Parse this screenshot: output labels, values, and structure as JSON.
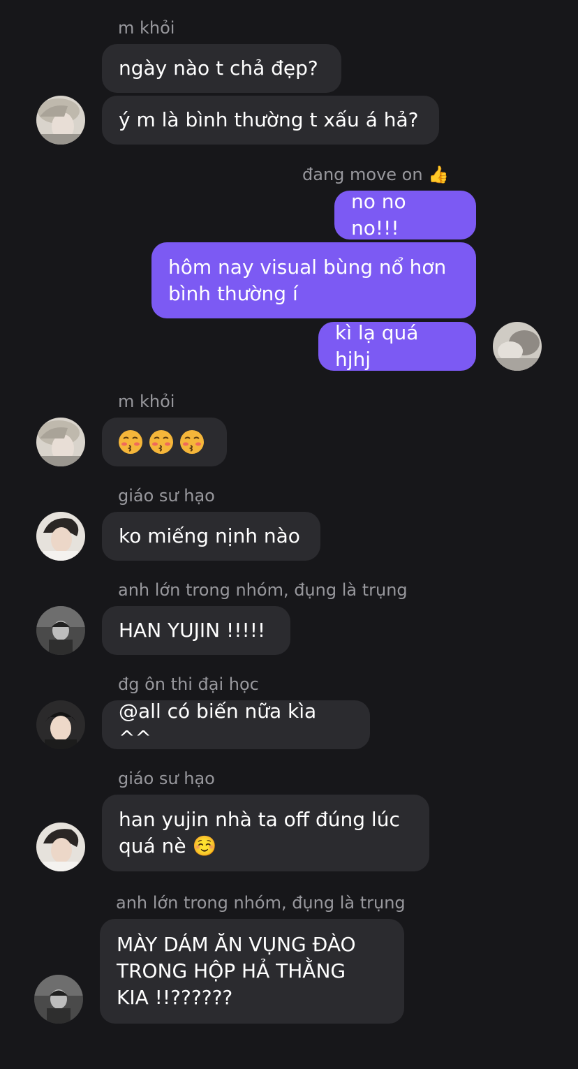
{
  "messages": {
    "m1": {
      "sender": "m khỏi",
      "lines": [
        "ngày nào t chả đẹp?",
        "ý m là bình thường t xấu á hả?"
      ]
    },
    "m2": {
      "sender": "đang move on 👍",
      "lines": [
        "no no no!!!",
        "hôm nay visual bùng nổ hơn\nbình thường í",
        "kì lạ quá hjhj"
      ]
    },
    "m3": {
      "sender": "m khỏi",
      "lines": [
        "😚😚😚"
      ]
    },
    "m4": {
      "sender": "giáo sư hạo",
      "lines": [
        "ko miếng nịnh nào"
      ]
    },
    "m5": {
      "sender": "anh lớn trong nhóm, đụng là trụng",
      "lines": [
        "HAN YUJIN !!!!!"
      ]
    },
    "m6": {
      "sender": "đg ôn thi đại học",
      "lines": [
        "@all có biến nữa kìa ^^"
      ]
    },
    "m7": {
      "sender": "giáo sư hạo",
      "lines": [
        "han yujin nhà ta off đúng lúc\nquá nè ☺️"
      ]
    },
    "m8": {
      "sender": "anh lớn trong nhóm, đụng là trụng",
      "lines": [
        "MÀY DÁM ĂN VỤNG ĐÀO\nTRONG HỘP HẢ THẰNG\nKIA !!??????"
      ]
    }
  },
  "avatars": {
    "khoi": "avatar-m-khoi",
    "self": "avatar-self",
    "hao": "avatar-giao-su-hao",
    "anh_lon": "avatar-anh-lon",
    "dg": "avatar-dg-on-thi"
  },
  "colors": {
    "background": "#17171a",
    "incoming_bubble": "#2b2b2f",
    "outgoing_bubble": "#7c5af3",
    "sender_name": "#98989d"
  }
}
